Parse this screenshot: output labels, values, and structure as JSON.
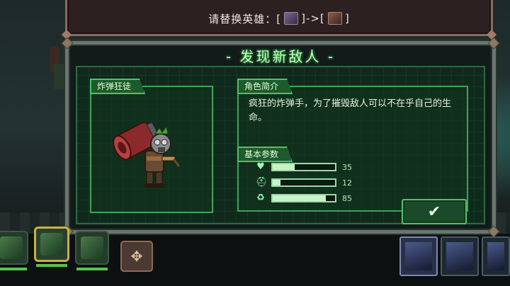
{
  "banner": {
    "prefix": "请替换英雄：[",
    "arrow": "]->[",
    "suffix": "]"
  },
  "dialog": {
    "title": "- 发现新敌人 -"
  },
  "character": {
    "name": "炸弹狂徒"
  },
  "profile": {
    "section_label": "角色简介",
    "description": "疯狂的炸弹手，为了摧毁敌人可以不在乎自己的生命。"
  },
  "stats": {
    "section_label": "基本参数",
    "rows": [
      {
        "icon": "heart-icon",
        "value": "35",
        "fraction": 0.35
      },
      {
        "icon": "helmet-icon",
        "value": "12",
        "fraction": 0.12
      },
      {
        "icon": "speed-icon",
        "value": "85",
        "fraction": 0.85
      }
    ]
  },
  "colors": {
    "accent": "#4cc46a",
    "panel": "#0f2a1c",
    "selected_slot": "#c8b23c"
  },
  "confirm": {
    "icon": "checkmark-icon",
    "glyph": "✔"
  },
  "swap": {
    "icon": "move-arrows-icon",
    "glyph": "✥"
  }
}
